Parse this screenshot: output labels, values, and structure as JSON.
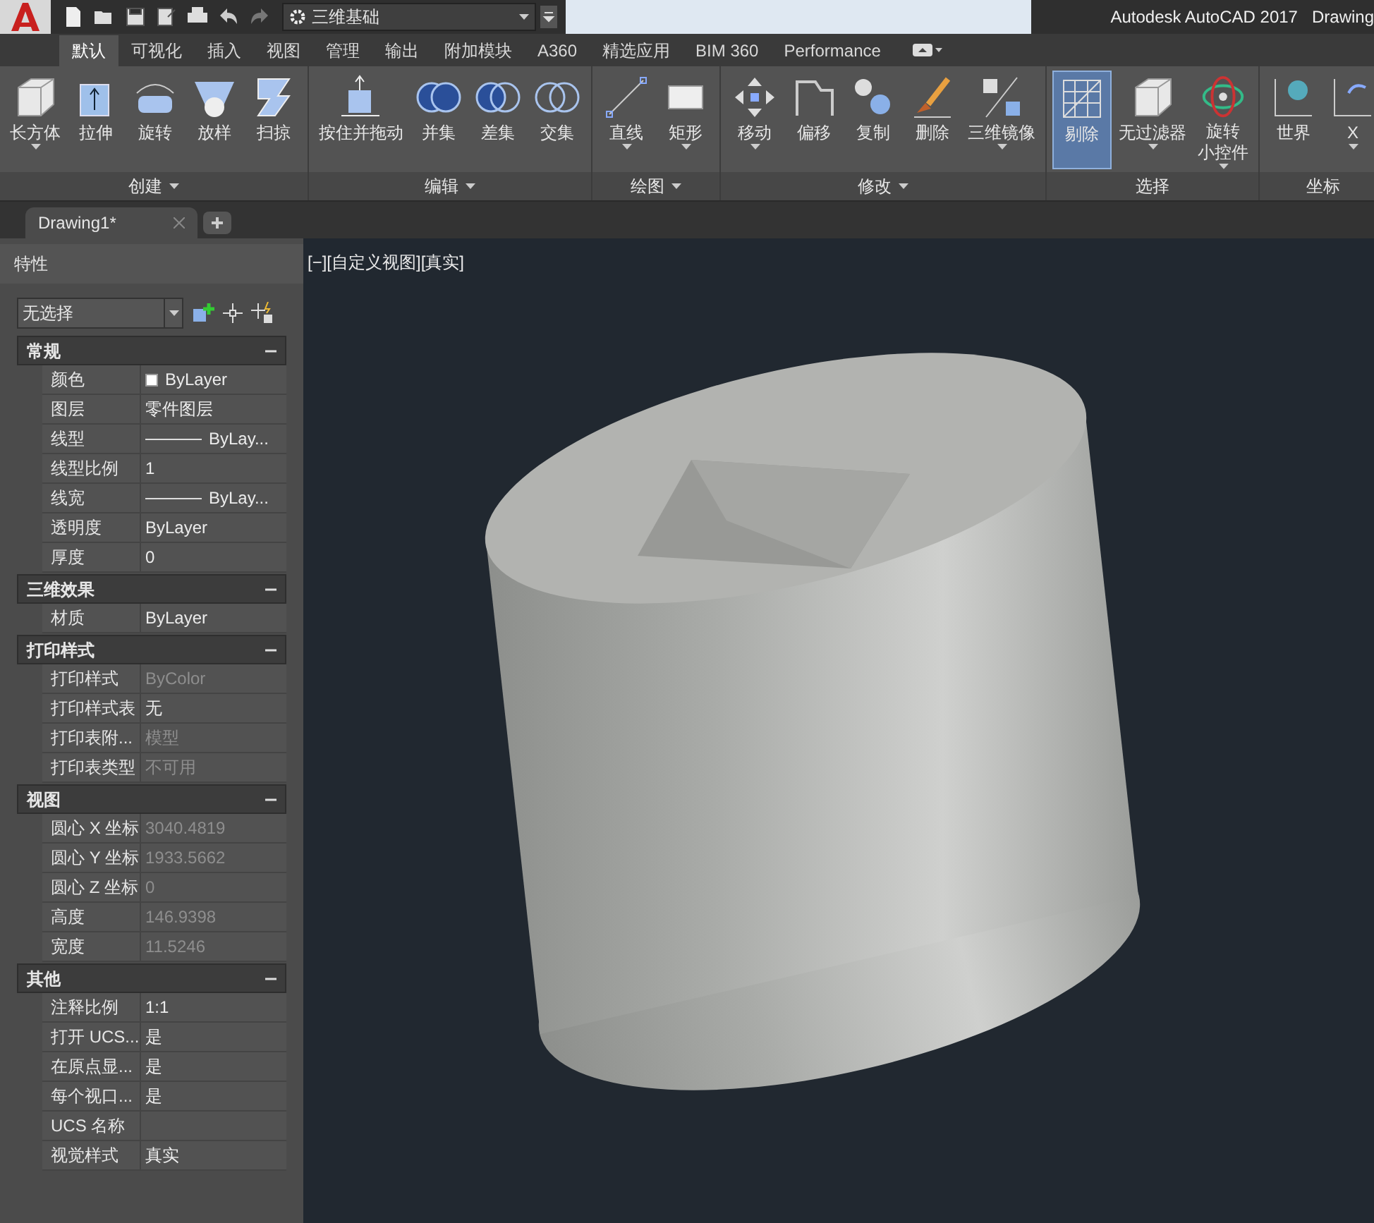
{
  "title_bar": {
    "workspace": "三维基础",
    "app_title": "Autodesk AutoCAD 2017",
    "document_title": "Drawing"
  },
  "ribbon_tabs": [
    {
      "label": "默认",
      "selected": true
    },
    {
      "label": "可视化",
      "selected": false
    },
    {
      "label": "插入",
      "selected": false
    },
    {
      "label": "视图",
      "selected": false
    },
    {
      "label": "管理",
      "selected": false
    },
    {
      "label": "输出",
      "selected": false
    },
    {
      "label": "附加模块",
      "selected": false
    },
    {
      "label": "A360",
      "selected": false
    },
    {
      "label": "精选应用",
      "selected": false
    },
    {
      "label": "BIM 360",
      "selected": false
    },
    {
      "label": "Performance",
      "selected": false
    }
  ],
  "ribbon_groups": [
    {
      "label": "创建",
      "dropdown": true,
      "tools": [
        {
          "label": "长方体",
          "dropdown": true,
          "selected": false
        },
        {
          "label": "拉伸",
          "dropdown": false,
          "selected": false
        },
        {
          "label": "旋转",
          "dropdown": false,
          "selected": false
        },
        {
          "label": "放样",
          "dropdown": false,
          "selected": false
        },
        {
          "label": "扫掠",
          "dropdown": false,
          "selected": false
        }
      ]
    },
    {
      "label": "编辑",
      "dropdown": true,
      "tools": [
        {
          "label": "按住并拖动",
          "dropdown": false,
          "selected": false
        },
        {
          "label": "并集",
          "dropdown": false,
          "selected": false
        },
        {
          "label": "差集",
          "dropdown": false,
          "selected": false
        },
        {
          "label": "交集",
          "dropdown": false,
          "selected": false
        }
      ]
    },
    {
      "label": "绘图",
      "dropdown": true,
      "tools": [
        {
          "label": "直线",
          "dropdown": true,
          "selected": false
        },
        {
          "label": "矩形",
          "dropdown": true,
          "selected": false
        }
      ]
    },
    {
      "label": "修改",
      "dropdown": true,
      "tools": [
        {
          "label": "移动",
          "dropdown": true,
          "selected": false
        },
        {
          "label": "偏移",
          "dropdown": false,
          "selected": false
        },
        {
          "label": "复制",
          "dropdown": false,
          "selected": false
        },
        {
          "label": "删除",
          "dropdown": false,
          "selected": false
        },
        {
          "label": "三维镜像",
          "dropdown": true,
          "selected": false
        }
      ]
    },
    {
      "label": "选择",
      "dropdown": false,
      "tools": [
        {
          "label": "剔除",
          "dropdown": false,
          "selected": true
        },
        {
          "label": "无过滤器",
          "dropdown": true,
          "selected": false
        },
        {
          "label": "旋转",
          "second_line": "小控件",
          "dropdown": true,
          "selected": false
        }
      ]
    },
    {
      "label": "坐标",
      "dropdown": false,
      "tools": [
        {
          "label": "世界",
          "dropdown": false,
          "selected": false
        },
        {
          "label": "X",
          "dropdown": true,
          "selected": false
        }
      ]
    }
  ],
  "document_tabs": [
    {
      "label": "Drawing1*",
      "selected": true
    }
  ],
  "properties": {
    "title": "特性",
    "selection": "无选择",
    "sections": [
      {
        "title": "常规",
        "expanded": true,
        "rows": [
          {
            "label": "颜色",
            "value": "ByLayer",
            "kind": "color",
            "disabled": false
          },
          {
            "label": "图层",
            "value": "零件图层",
            "kind": "text",
            "disabled": false
          },
          {
            "label": "线型",
            "value": "ByLay...",
            "kind": "linetype",
            "disabled": false
          },
          {
            "label": "线型比例",
            "value": "1",
            "kind": "text",
            "disabled": false
          },
          {
            "label": "线宽",
            "value": "ByLay...",
            "kind": "linetype",
            "disabled": false
          },
          {
            "label": "透明度",
            "value": "ByLayer",
            "kind": "text",
            "disabled": false
          },
          {
            "label": "厚度",
            "value": "0",
            "kind": "text",
            "disabled": false
          }
        ]
      },
      {
        "title": "三维效果",
        "expanded": true,
        "rows": [
          {
            "label": "材质",
            "value": "ByLayer",
            "kind": "text",
            "disabled": false
          }
        ]
      },
      {
        "title": "打印样式",
        "expanded": true,
        "rows": [
          {
            "label": "打印样式",
            "value": "ByColor",
            "kind": "text",
            "disabled": true
          },
          {
            "label": "打印样式表",
            "value": "无",
            "kind": "text",
            "disabled": false
          },
          {
            "label": "打印表附...",
            "value": "模型",
            "kind": "text",
            "disabled": true
          },
          {
            "label": "打印表类型",
            "value": "不可用",
            "kind": "text",
            "disabled": true
          }
        ]
      },
      {
        "title": "视图",
        "expanded": true,
        "rows": [
          {
            "label": "圆心 X 坐标",
            "value": "3040.4819",
            "kind": "text",
            "disabled": true
          },
          {
            "label": "圆心 Y 坐标",
            "value": "1933.5662",
            "kind": "text",
            "disabled": true
          },
          {
            "label": "圆心 Z 坐标",
            "value": "0",
            "kind": "text",
            "disabled": true
          },
          {
            "label": "高度",
            "value": "146.9398",
            "kind": "text",
            "disabled": true
          },
          {
            "label": "宽度",
            "value": "11.5246",
            "kind": "text",
            "disabled": true
          }
        ]
      },
      {
        "title": "其他",
        "expanded": true,
        "rows": [
          {
            "label": "注释比例",
            "value": "1:1",
            "kind": "text",
            "disabled": false
          },
          {
            "label": "打开 UCS...",
            "value": "是",
            "kind": "text",
            "disabled": false
          },
          {
            "label": "在原点显...",
            "value": "是",
            "kind": "text",
            "disabled": false
          },
          {
            "label": "每个视口...",
            "value": "是",
            "kind": "text",
            "disabled": false
          },
          {
            "label": "UCS 名称",
            "kind": "text",
            "disabled": false
          },
          {
            "label": "视觉样式",
            "value": "真实",
            "kind": "text",
            "disabled": false
          }
        ]
      }
    ]
  },
  "viewport": {
    "label": "[−][自定义视图][真实]"
  }
}
